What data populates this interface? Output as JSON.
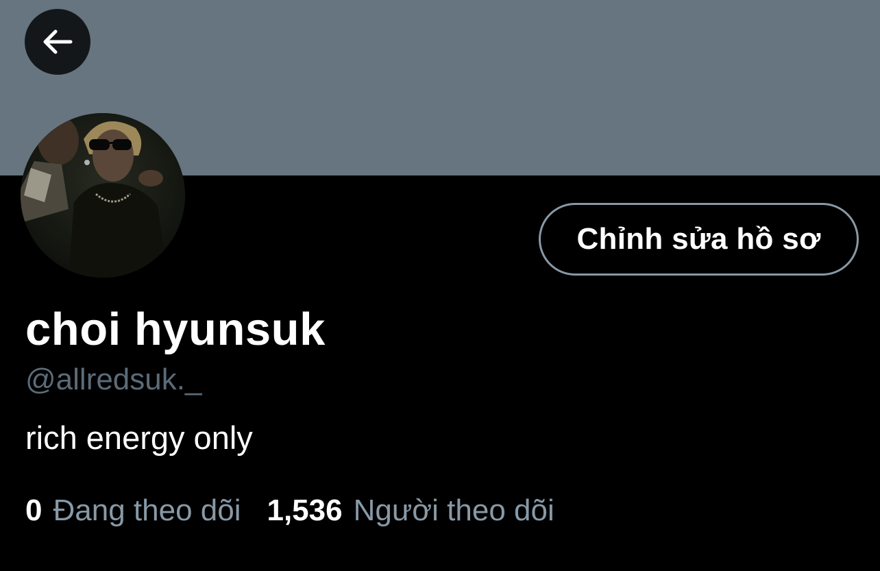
{
  "header": {
    "back_icon": "arrow-left-icon",
    "banner_color": "#66757f"
  },
  "profile": {
    "display_name": "choi hyunsuk",
    "handle": "@allredsuk._",
    "bio": "rich energy only",
    "edit_button_label": "Chỉnh sửa hồ sơ"
  },
  "stats": {
    "following_count": "0",
    "following_label": "Đang theo dõi",
    "followers_count": "1,536",
    "followers_label": "Người theo dõi"
  },
  "colors": {
    "background": "#000000",
    "primary_text": "#ffffff",
    "secondary_text": "#8899a6",
    "button_border": "#8899a6"
  }
}
